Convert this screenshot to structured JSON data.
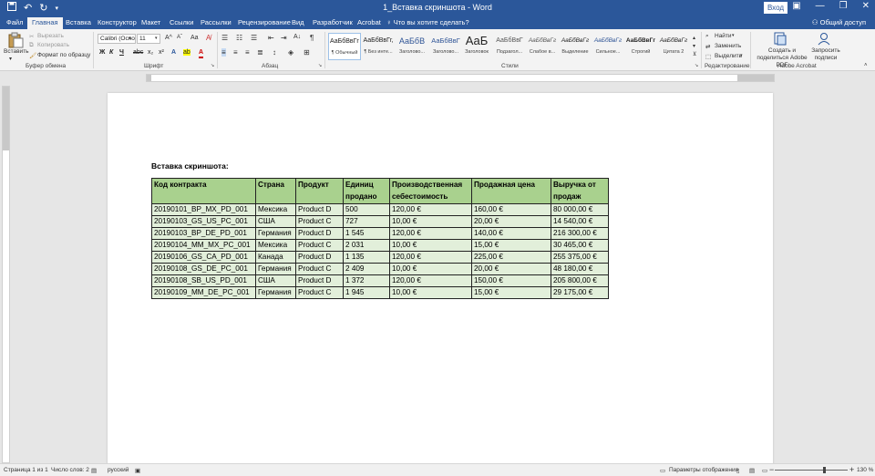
{
  "titlebar": {
    "title": "1_Вставка скриншота  -  Word",
    "login_label": "Вход",
    "minimize": "—",
    "restore": "❐",
    "close": "✕"
  },
  "tabs": [
    "Файл",
    "Главная",
    "Вставка",
    "Конструктор",
    "Макет",
    "Ссылки",
    "Рассылки",
    "Рецензирование",
    "Вид",
    "Разработчик",
    "Acrobat"
  ],
  "active_tab_index": 1,
  "tellme": "Что вы хотите сделать?",
  "share_label": "Общий доступ",
  "ribbon": {
    "clipboard": {
      "paste": "Вставить",
      "cut": "Вырезать",
      "copy": "Копировать",
      "format_painter": "Формат по образцу",
      "label": "Буфер обмена"
    },
    "font": {
      "name": "Calibri (Осно",
      "size": "11",
      "bold": "Ж",
      "italic": "К",
      "underline": "Ч",
      "label": "Шрифт"
    },
    "paragraph": {
      "label": "Абзац"
    },
    "styles": {
      "items": [
        {
          "preview": "АаБбВвГг",
          "name": "¶ Обычный"
        },
        {
          "preview": "АаБбВвГг,",
          "name": "¶ Без инте..."
        },
        {
          "preview": "АаБбВ",
          "name": "Заголово..."
        },
        {
          "preview": "АаБбВвГ",
          "name": "Заголово..."
        },
        {
          "preview": "АаБ",
          "name": "Заголовок"
        },
        {
          "preview": "АаБбВвГ",
          "name": "Подзагол..."
        },
        {
          "preview": "АаБбВвГг",
          "name": "Слабое в..."
        },
        {
          "preview": "АаБбВвГг",
          "name": "Выделение"
        },
        {
          "preview": "АаБбВвГг",
          "name": "Сильное..."
        },
        {
          "preview": "АаБбВвГг",
          "name": "Строгий"
        },
        {
          "preview": "АаБбВвГг",
          "name": "Цитата 2"
        }
      ],
      "label": "Стили"
    },
    "editing": {
      "find": "Найти",
      "replace": "Заменить",
      "select": "Выделить",
      "label": "Редактирование"
    },
    "acrobat": {
      "create_share": "Создать и поделиться Adobe PDF",
      "request_sign": "Запросить подписи",
      "label": "Adobe Acrobat"
    }
  },
  "document": {
    "heading": "Вставка скриншота:",
    "table": {
      "headers": [
        "Код контракта",
        "Страна",
        "Продукт",
        "Единиц продано",
        "Производственная себестоимость",
        "Продажная цена",
        "Выручка от продаж"
      ],
      "rows": [
        [
          "20190101_BP_MX_PD_001",
          "Мексика",
          "Product D",
          "500",
          "120,00 €",
          "160,00 €",
          "80 000,00 €"
        ],
        [
          "20190103_GS_US_PC_001",
          "США",
          "Product C",
          "727",
          "10,00 €",
          "20,00 €",
          "14 540,00 €"
        ],
        [
          "20190103_BP_DE_PD_001",
          "Германия",
          "Product D",
          "1 545",
          "120,00 €",
          "140,00 €",
          "216 300,00 €"
        ],
        [
          "20190104_MM_MX_PC_001",
          "Мексика",
          "Product C",
          "2 031",
          "10,00 €",
          "15,00 €",
          "30 465,00 €"
        ],
        [
          "20190106_GS_CA_PD_001",
          "Канада",
          "Product D",
          "1 135",
          "120,00 €",
          "225,00 €",
          "255 375,00 €"
        ],
        [
          "20190108_GS_DE_PC_001",
          "Германия",
          "Product C",
          "2 409",
          "10,00 €",
          "20,00 €",
          "48 180,00 €"
        ],
        [
          "20190108_SB_US_PD_001",
          "США",
          "Product D",
          "1 372",
          "120,00 €",
          "150,00 €",
          "205 800,00 €"
        ],
        [
          "20190109_MM_DE_PC_001",
          "Германия",
          "Product C",
          "1 945",
          "10,00 €",
          "15,00 €",
          "29 175,00 €"
        ]
      ]
    }
  },
  "statusbar": {
    "page": "Страница 1 из 1",
    "words": "Число слов: 2",
    "language": "русский",
    "display_settings": "Параметры отображения",
    "zoom_minus": "−",
    "zoom_plus": "+",
    "zoom": "130 %"
  },
  "colors": {
    "titlebar": "#2b579a",
    "header_fill": "#a9d18e",
    "row_fill": "#e2efda"
  }
}
